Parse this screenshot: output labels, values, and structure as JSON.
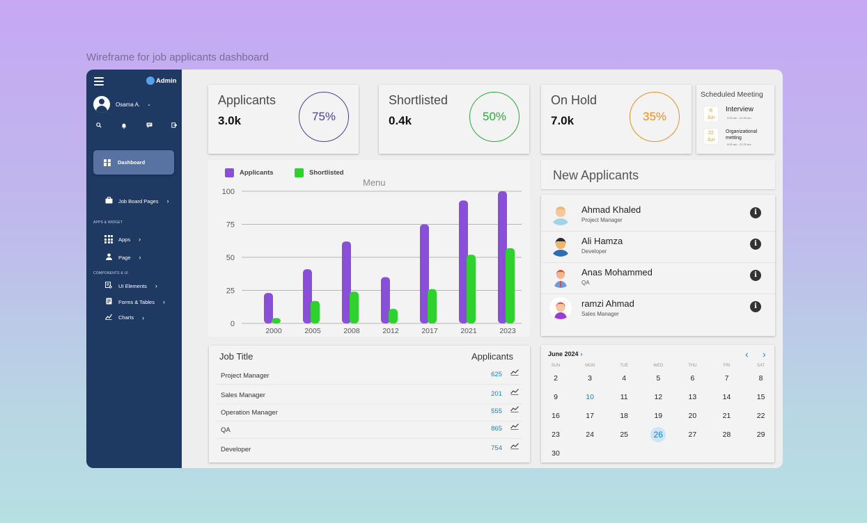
{
  "page_caption": "Wireframe for job applicants dashboard",
  "sidebar": {
    "brand": "Admin",
    "user_name": "Osama A.",
    "quick_icons": [
      "search-icon",
      "bell-icon",
      "chat-icon",
      "logout-icon"
    ],
    "dashboard_label": "Dashboard",
    "job_board_label": "Job Board Pages",
    "section_apps": "APPS & WIDGET",
    "apps_label": "Apps",
    "page_label": "Page",
    "section_components": "COMPONENTS & UI",
    "ui_elements_label": "UI Elements",
    "forms_tables_label": "Forms & Tables",
    "charts_label": "Charts"
  },
  "stats": [
    {
      "title": "Applicants",
      "value": "3.0k",
      "percent_label": "75%",
      "percent": 75,
      "color": "#4b3f9a"
    },
    {
      "title": "Shortlisted",
      "value": "0.4k",
      "percent_label": "50%",
      "percent": 50,
      "color": "#2ca83a"
    },
    {
      "title": "On Hold",
      "value": "7.0k",
      "percent_label": "35%",
      "percent": 35,
      "color": "#e8902a"
    }
  ],
  "meeting": {
    "title": "Scheduled Meeting",
    "items": [
      {
        "day": "8",
        "month": "Jun",
        "name": "Interview",
        "time": "9:00 am - 22:20 am"
      },
      {
        "day": "22",
        "month": "Jun",
        "name": "Organizational metting",
        "time": "9:00 am - 22:20 am"
      }
    ]
  },
  "chart_data": {
    "type": "bar",
    "caption": "Menu",
    "categories": [
      "2000",
      "2005",
      "2008",
      "2012",
      "2017",
      "2021",
      "2023"
    ],
    "series": [
      {
        "name": "Applicants",
        "color": "#8a4fd8",
        "values": [
          23,
          41,
          62,
          35,
          75,
          93,
          100
        ]
      },
      {
        "name": "Shortlisted",
        "color": "#2ed12e",
        "values": [
          4,
          17,
          24,
          11,
          26,
          52,
          57
        ]
      }
    ],
    "ylim": [
      0,
      100
    ],
    "yticks": [
      0,
      25,
      50,
      75,
      100
    ],
    "grid": true,
    "legend": "top-left"
  },
  "new_applicants": {
    "title": "New Applicants",
    "items": [
      {
        "name": "Ahmad Khaled",
        "role": "Project Manager"
      },
      {
        "name": "Ali Hamza",
        "role": "Developer"
      },
      {
        "name": "Anas Mohammed",
        "role": "QA"
      },
      {
        "name": "ramzi Ahmad",
        "role": "Sales Manager"
      }
    ]
  },
  "jobs": {
    "header_title": "Job Title",
    "header_count": "Applicants",
    "rows": [
      {
        "title": "Project Manager",
        "count": "625"
      },
      {
        "title": "Sales Manager",
        "count": "201"
      },
      {
        "title": "Operation Manager",
        "count": "555"
      },
      {
        "title": "QA",
        "count": "865"
      },
      {
        "title": "Developer",
        "count": "754"
      }
    ]
  },
  "calendar": {
    "month": "June 2024",
    "prev": "‹",
    "next": "›",
    "weekdays": [
      "SUN",
      "MON",
      "TUE",
      "WED",
      "THU",
      "FRI",
      "SAT"
    ],
    "weeks": [
      [
        "2",
        "3",
        "4",
        "5",
        "6",
        "7",
        "8"
      ],
      [
        "9",
        "10",
        "11",
        "12",
        "13",
        "14",
        "15"
      ],
      [
        "16",
        "17",
        "18",
        "19",
        "20",
        "21",
        "22"
      ],
      [
        "23",
        "24",
        "25",
        "26",
        "27",
        "28",
        "29"
      ],
      [
        "30"
      ]
    ],
    "highlighted_day": "10",
    "selected_day": "26"
  }
}
